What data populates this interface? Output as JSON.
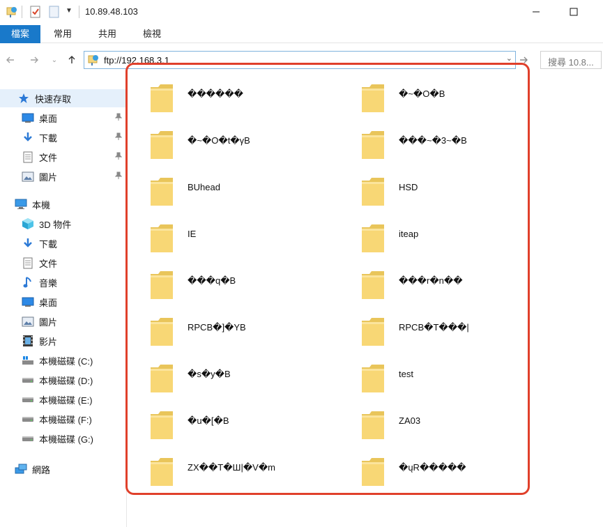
{
  "window": {
    "title": "10.89.48.103"
  },
  "ribbon": {
    "tabs": [
      {
        "label": "檔案",
        "active": true
      },
      {
        "label": "常用",
        "active": false
      },
      {
        "label": "共用",
        "active": false
      },
      {
        "label": "檢視",
        "active": false
      }
    ]
  },
  "address_bar": {
    "value": "ftp://192.168.3.1",
    "search_placeholder": "搜尋 10.8..."
  },
  "sidebar": {
    "quick_access": {
      "label": "快速存取",
      "items": [
        {
          "label": "桌面",
          "icon": "desktop-icon",
          "pinned": true
        },
        {
          "label": "下載",
          "icon": "download-icon",
          "pinned": true
        },
        {
          "label": "文件",
          "icon": "document-icon",
          "pinned": true
        },
        {
          "label": "圖片",
          "icon": "pictures-icon",
          "pinned": true
        }
      ]
    },
    "this_pc": {
      "label": "本機",
      "items": [
        {
          "label": "3D 物件",
          "icon": "3d-objects-icon"
        },
        {
          "label": "下載",
          "icon": "download-icon"
        },
        {
          "label": "文件",
          "icon": "document-icon"
        },
        {
          "label": "音樂",
          "icon": "music-icon"
        },
        {
          "label": "桌面",
          "icon": "desktop-icon"
        },
        {
          "label": "圖片",
          "icon": "pictures-icon"
        },
        {
          "label": "影片",
          "icon": "video-icon"
        },
        {
          "label": "本機磁碟 (C:)",
          "icon": "system-drive-icon"
        },
        {
          "label": "本機磁碟 (D:)",
          "icon": "drive-icon"
        },
        {
          "label": "本機磁碟 (E:)",
          "icon": "drive-icon"
        },
        {
          "label": "本機磁碟 (F:)",
          "icon": "drive-icon"
        },
        {
          "label": "本機磁碟 (G:)",
          "icon": "drive-icon"
        }
      ]
    },
    "network": {
      "label": "網路"
    }
  },
  "folders": [
    {
      "name": "������"
    },
    {
      "name": "�~�O�B"
    },
    {
      "name": "�~�O�t�γB"
    },
    {
      "name": "���~�3~�B"
    },
    {
      "name": "BUhead"
    },
    {
      "name": "HSD"
    },
    {
      "name": "IE"
    },
    {
      "name": "iteap"
    },
    {
      "name": "���q�B"
    },
    {
      "name": "���r�n��"
    },
    {
      "name": "RPCB�]�YB"
    },
    {
      "name": "RPCB�T���|"
    },
    {
      "name": "�s�y�B"
    },
    {
      "name": "test"
    },
    {
      "name": "�u�[�B"
    },
    {
      "name": "ZA03"
    },
    {
      "name": "ZX��T�Ш|�V�m"
    },
    {
      "name": "�ųR�����"
    }
  ],
  "colors": {
    "ribbon_active": "#1979ca",
    "highlight_border": "#e0402b",
    "folder_yellow": "#f8d775"
  }
}
